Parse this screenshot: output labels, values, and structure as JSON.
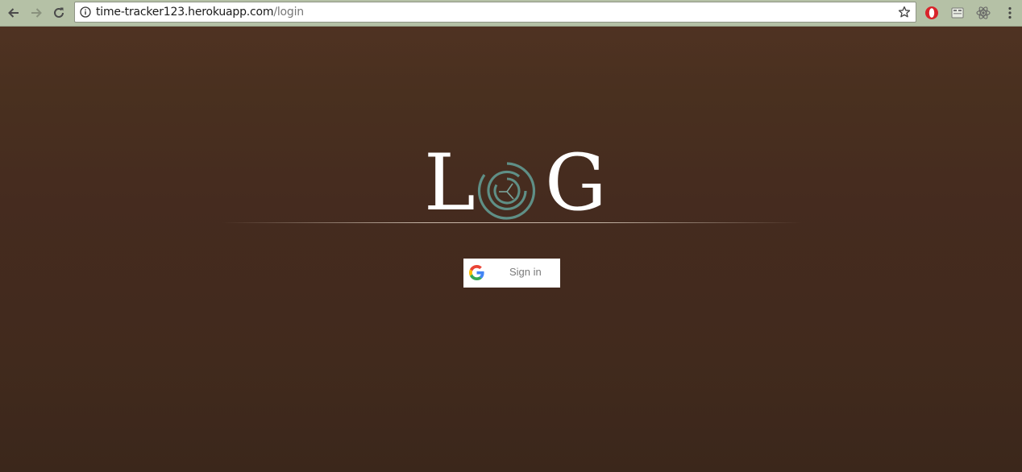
{
  "browser": {
    "url_host": "time-tracker123.herokuapp.com",
    "url_path": "/login",
    "icons": {
      "back": "back-arrow-icon",
      "forward": "forward-arrow-icon",
      "reload": "reload-icon",
      "info": "info-icon",
      "bookmark": "star-icon",
      "extensions": [
        "opera-icon",
        "extension-icon",
        "react-icon"
      ],
      "menu": "kebab-menu-icon"
    }
  },
  "page": {
    "logo": {
      "letter_left": "L",
      "letter_right": "G"
    },
    "signin": {
      "label": "Sign in",
      "icon": "google-g-icon"
    }
  },
  "colors": {
    "background_top": "#4f3222",
    "background_bottom": "#3b271b",
    "logo_clock": "#5f8f86",
    "logo_text": "#ffffff",
    "toolbar": "#b5c1a6"
  }
}
